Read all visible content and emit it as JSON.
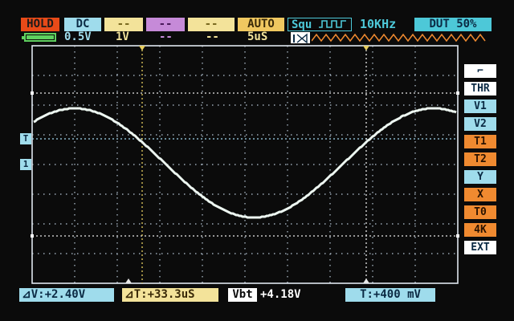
{
  "colors": {
    "hold_bg": "#e84a18",
    "hold_fg": "#1a1a1a",
    "cyan": "#4dc8d8",
    "cyan_fg": "#0b2a44",
    "orange": "#f08a30",
    "yellow": "#f3e39a",
    "magenta": "#c68ad8",
    "trace": "#eef8f2",
    "grid": "#b8c8d8",
    "dotline": "#9fd6ee",
    "cursor_yellow": "#e8cf60",
    "white_text": "#f0f0f0",
    "panel": "#ffffff"
  },
  "top_bar": {
    "hold": "HOLD",
    "coupling": "DC",
    "ch_a": "--",
    "ch_b": "--",
    "ch_c": "--",
    "trigger_mode": "AUTO",
    "waveform": "Squ",
    "waveform_icon": "square-wave-icon",
    "frequency": "10KHz",
    "duty": "DUT 50%"
  },
  "second_bar": {
    "battery_icon": "battery-icon",
    "v_per_div": "0.5V",
    "probe": "1V",
    "ch_b_val": "--",
    "ch_c_val": "--",
    "time_per_div": "5uS",
    "trigger_marker_icon": "trigger-position-icon"
  },
  "side_menu": [
    {
      "label": "⌐",
      "name": "trigger-edge-icon",
      "style": "white"
    },
    {
      "label": "THR",
      "name": "menu-thr",
      "style": "white"
    },
    {
      "label": "V1",
      "name": "menu-v1",
      "style": "cyan"
    },
    {
      "label": "V2",
      "name": "menu-v2",
      "style": "cyan"
    },
    {
      "label": "T1",
      "name": "menu-t1",
      "style": "orange"
    },
    {
      "label": "T2",
      "name": "menu-t2",
      "style": "orange"
    },
    {
      "label": "Y",
      "name": "menu-y",
      "style": "cyan"
    },
    {
      "label": "X",
      "name": "menu-x",
      "style": "orange"
    },
    {
      "label": "T0",
      "name": "menu-t0",
      "style": "orange"
    },
    {
      "label": "4K",
      "name": "menu-4k",
      "style": "orange"
    },
    {
      "label": "EXT",
      "name": "menu-ext",
      "style": "white"
    }
  ],
  "left_markers": {
    "trigger": "T",
    "channel": "1"
  },
  "bottom_bar": {
    "delta_v": "⊿V:+2.40V",
    "delta_t": "⊿T:+33.3uS",
    "vbt_label": "Vbt",
    "vbt_value": "+4.18V",
    "trigger_level": "T:+400 mV"
  },
  "chart_data": {
    "type": "line",
    "series": [
      {
        "values_desc": "sine wave",
        "periods": 1,
        "amplitude_v": 1.2,
        "offset_v": 0.35
      }
    ],
    "v_per_div": 0.5,
    "time_per_div_us": 5,
    "grid": true
  }
}
